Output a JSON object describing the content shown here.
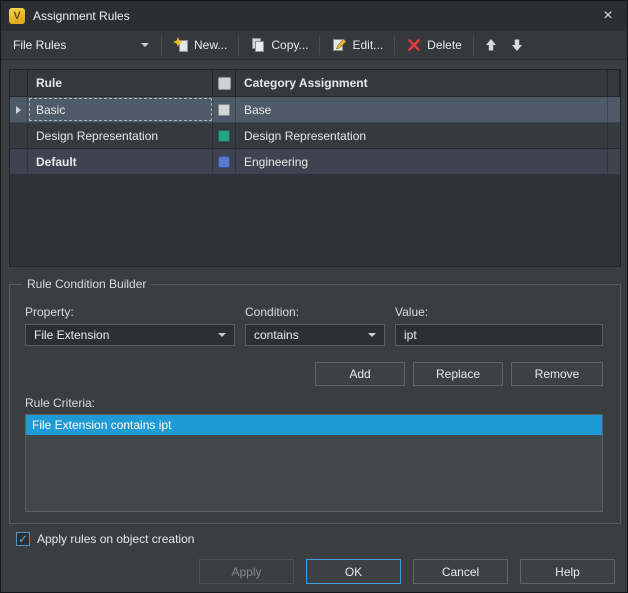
{
  "window": {
    "title": "Assignment Rules",
    "icon_letter": "V",
    "close_glyph": "×"
  },
  "toolbar": {
    "ruleset_value": "File Rules",
    "new_label": "New...",
    "copy_label": "Copy...",
    "edit_label": "Edit...",
    "delete_label": "Delete"
  },
  "grid": {
    "header": {
      "rule": "Rule",
      "category": "Category Assignment"
    },
    "rows": [
      {
        "rule": "Basic",
        "category": "Base",
        "swatch": "#d3d6d8"
      },
      {
        "rule": "Design Representation",
        "category": "Design Representation",
        "swatch": "#2aa288"
      },
      {
        "rule": "Default",
        "category": "Engineering",
        "swatch": "#5b79cf"
      }
    ]
  },
  "builder": {
    "title": "Rule Condition Builder",
    "property_label": "Property:",
    "property_value": "File Extension",
    "condition_label": "Condition:",
    "condition_value": "contains",
    "value_label": "Value:",
    "value_text": "ipt",
    "add_label": "Add",
    "replace_label": "Replace",
    "remove_label": "Remove",
    "criteria_label": "Rule Criteria:",
    "criteria_items": [
      "File Extension contains ipt"
    ]
  },
  "footer": {
    "checkbox_label": "Apply rules on object creation",
    "check_glyph": "✓",
    "apply_label": "Apply",
    "ok_label": "OK",
    "cancel_label": "Cancel",
    "help_label": "Help"
  },
  "colors": {
    "accent": "#1e9ad6"
  }
}
